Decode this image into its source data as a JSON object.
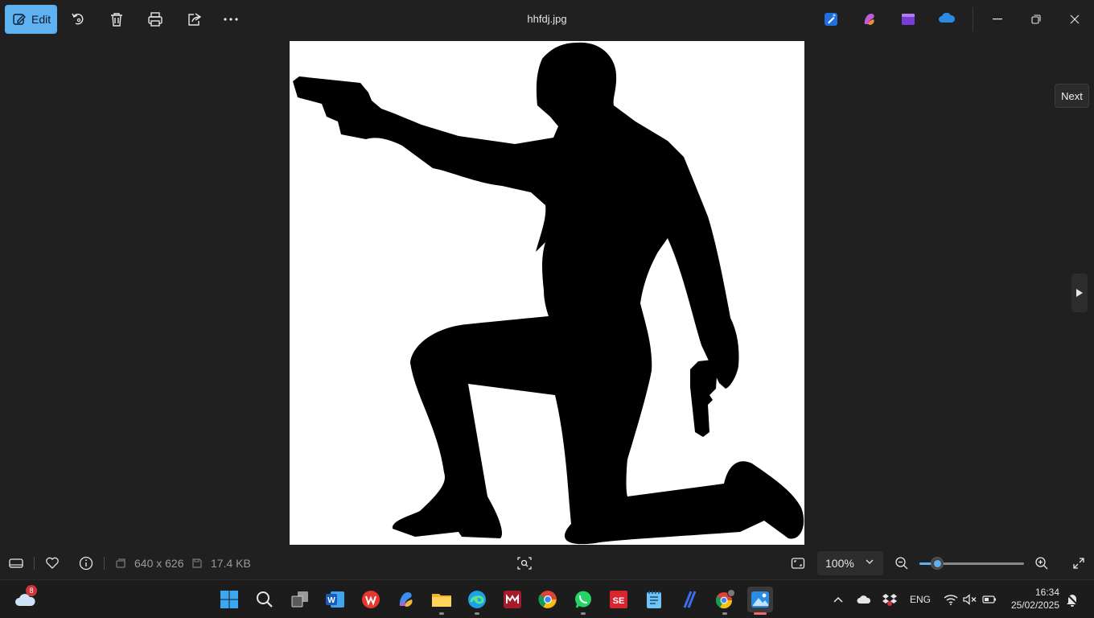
{
  "toolbar": {
    "edit_label": "Edit",
    "file_name": "hhfdj.jpg",
    "icons": [
      "rotate-icon",
      "delete-icon",
      "print-icon",
      "share-icon",
      "more-icon"
    ],
    "app_icons": [
      "designer-icon",
      "copilot-icon",
      "clipchamp-icon",
      "onedrive-icon"
    ]
  },
  "viewer": {
    "next_tooltip": "Next"
  },
  "status": {
    "dimensions": "640 x 626",
    "file_size": "17.4 KB",
    "zoom": "100%",
    "zoom_slider_fraction": 0.17
  },
  "taskbar": {
    "weather_badge": "8",
    "apps": [
      "start",
      "search",
      "task-view",
      "word",
      "wps",
      "copilot",
      "file-explorer",
      "edge",
      "mendeley",
      "chrome",
      "whatsapp",
      "app-se",
      "notepad",
      "app-slash",
      "chrome-profile",
      "photos"
    ],
    "language": "ENG",
    "time": "16:34",
    "date": "25/02/2025"
  },
  "colors": {
    "accent": "#5fb2f2",
    "background": "#202020",
    "active_indicator": "#f06a78"
  }
}
